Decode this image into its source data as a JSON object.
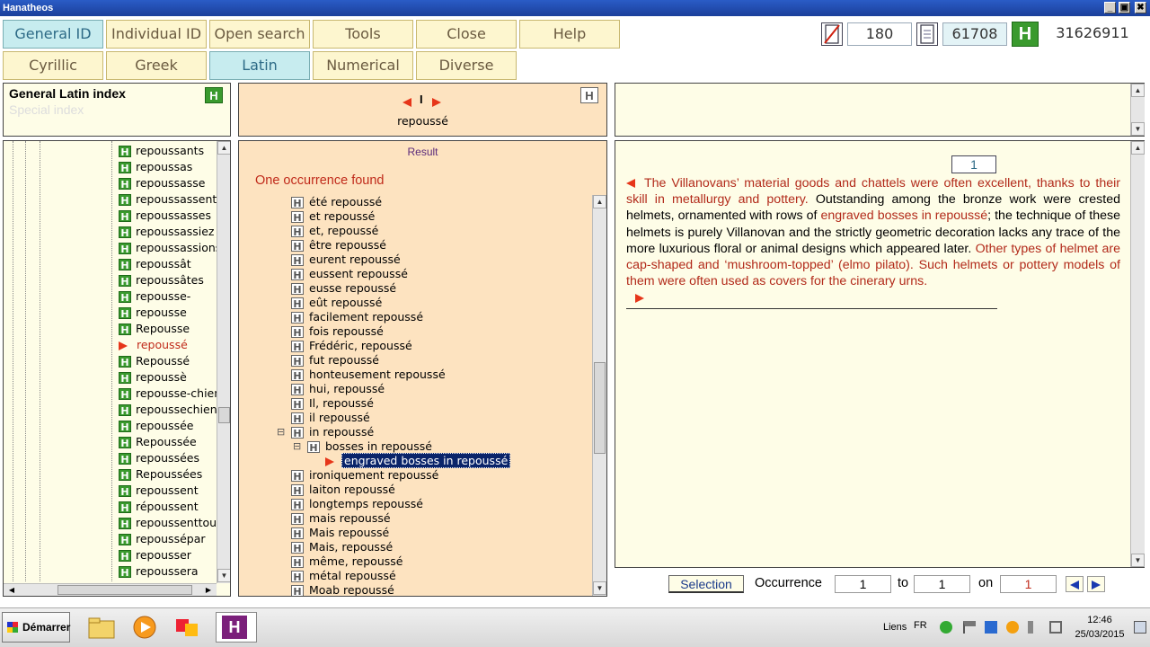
{
  "window": {
    "title": "Hanatheos",
    "btn_min": "_",
    "btn_max": "▣",
    "btn_close": "✖"
  },
  "toolbar": {
    "tabs": [
      "General ID",
      "Individual ID",
      "Open search",
      "Tools",
      "Close",
      "Help"
    ],
    "subtabs": [
      "Cyrillic",
      "Greek",
      "Latin",
      "Numerical",
      "Diverse"
    ],
    "active_subtab": "Latin",
    "counters": {
      "c1": "180",
      "c2": "61708",
      "c3": "31626911"
    }
  },
  "index_panel": {
    "title": "General Latin index",
    "subtitle": "Special index"
  },
  "word_nav": {
    "separator": "I",
    "word": "repoussé"
  },
  "word_list": [
    "repoussants",
    "repoussas",
    "repoussasse",
    "repoussassent",
    "repoussasses",
    "repoussassiez",
    "repoussassions",
    "repoussât",
    "repoussâtes",
    "repousse-",
    "repousse",
    "Repousse",
    "repoussé",
    "Repoussé",
    "repoussè",
    "repousse-chien",
    "repoussechien",
    "repoussée",
    "Repoussée",
    "repoussées",
    "Repoussées",
    "repoussent",
    "répoussent",
    "repoussenttout",
    "repoussépar",
    "repousser",
    "repoussera"
  ],
  "word_list_selected": "repoussé",
  "result": {
    "header": "Result",
    "summary": "One occurrence found",
    "items": [
      "été repoussé",
      "et repoussé",
      "et, repoussé",
      "être repoussé",
      "eurent repoussé",
      "eussent repoussé",
      "eusse repoussé",
      "eût repoussé",
      "facilement repoussé",
      "fois repoussé",
      "Frédéric, repoussé",
      "fut repoussé",
      "honteusement repoussé",
      "hui, repoussé",
      "Il, repoussé",
      "il repoussé",
      "in repoussé",
      "bosses in repoussé",
      "engraved bosses in repoussé",
      "ironiquement repoussé",
      "laiton repoussé",
      "longtemps repoussé",
      "mais repoussé",
      "Mais repoussé",
      "Mais, repoussé",
      "même, repoussé",
      "métal repoussé",
      "Moab repoussé"
    ],
    "selected": "engraved bosses in repoussé"
  },
  "text_panel": {
    "page": "1",
    "segments": [
      {
        "t": "The Villanovans’ material goods and chattels were often excellent, thanks to their skill in metallurgy and pottery.",
        "red": true
      },
      {
        "t": " Outstanding among the bronze work were crested helmets, ornamented with rows of ",
        "red": false
      },
      {
        "t": "engraved bosses in repoussé",
        "red": true
      },
      {
        "t": "; the technique of these helmets is purely Villanovan and the strictly geometric decoration lacks any trace of the more luxurious floral or animal designs which appeared later. ",
        "red": false
      },
      {
        "t": "Other types of helmet are cap-shaped and ‘mushroom-topped’ (elmo pilato). Such helmets or pottery models of them were often used as covers for the cinerary urns.",
        "red": true
      }
    ]
  },
  "bottom_bar": {
    "selection_label": "Selection",
    "occurrence_label": "Occurrence",
    "from": "1",
    "to_label": "to",
    "to": "1",
    "on_label": "on",
    "total": "1"
  },
  "taskbar": {
    "start_label": "Démarrer",
    "links_label": "Liens",
    "lang": "FR",
    "time": "12:46",
    "date": "25/03/2015"
  },
  "colors": {
    "accent_red": "#e6361a",
    "text_red": "#b22a1a",
    "cream": "#fefde7",
    "peach": "#fde3c0"
  }
}
